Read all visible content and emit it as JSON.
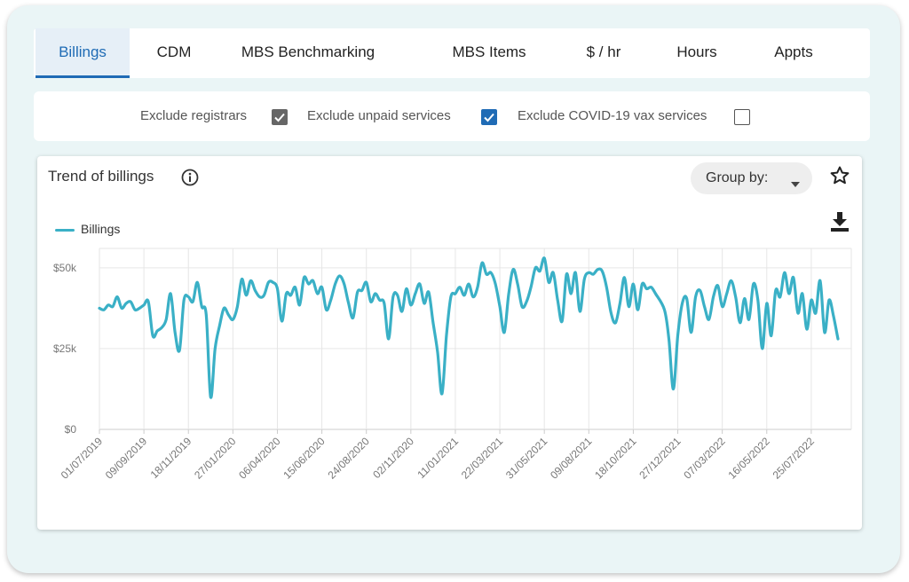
{
  "tabs": [
    {
      "label": "Billings",
      "active": true
    },
    {
      "label": "CDM",
      "active": false
    },
    {
      "label": "MBS Benchmarking",
      "active": false
    },
    {
      "label": "MBS Items",
      "active": false
    },
    {
      "label": "$ / hr",
      "active": false
    },
    {
      "label": "Hours",
      "active": false
    },
    {
      "label": "Appts",
      "active": false
    }
  ],
  "filters": [
    {
      "label": "Exclude registrars",
      "checked": true,
      "style": "gray"
    },
    {
      "label": "Exclude unpaid services",
      "checked": true,
      "style": "blue"
    },
    {
      "label": "Exclude COVID-19 vax services",
      "checked": false,
      "style": "none"
    }
  ],
  "colors": {
    "accent": "#1f6bb5",
    "series": "#3ab0c6",
    "checkbox_gray": "#666666",
    "checkbox_blue": "#1f6bb5"
  },
  "card": {
    "title": "Trend of billings",
    "group_by_label": "Group by:",
    "icons": [
      "info-icon",
      "star-icon",
      "download-icon",
      "caret-down-icon"
    ]
  },
  "chart_data": {
    "type": "line",
    "title": "Trend of billings",
    "xlabel": "",
    "ylabel": "",
    "ylim": [
      0,
      56000
    ],
    "y_ticks": [
      0,
      25000,
      50000
    ],
    "y_tick_labels": [
      "$0",
      "$25k",
      "$50k"
    ],
    "x_tick_labels": [
      "01/07/2019",
      "09/09/2019",
      "18/11/2019",
      "27/01/2020",
      "06/04/2020",
      "15/06/2020",
      "24/08/2020",
      "02/11/2020",
      "11/01/2021",
      "22/03/2021",
      "31/05/2021",
      "09/08/2021",
      "18/10/2021",
      "27/12/2021",
      "07/03/2022",
      "16/05/2022",
      "25/07/2022"
    ],
    "x_start": "2019-07-01",
    "x_end": "2022-09-26",
    "grid": true,
    "legend": "top-left",
    "series": [
      {
        "name": "Billings",
        "color": "#3ab0c6",
        "points": [
          [
            "2019-07-01",
            37500
          ],
          [
            "2019-07-08",
            37000
          ],
          [
            "2019-07-15",
            38500
          ],
          [
            "2019-07-22",
            38000
          ],
          [
            "2019-07-29",
            41000
          ],
          [
            "2019-08-05",
            37500
          ],
          [
            "2019-08-12",
            39000
          ],
          [
            "2019-08-19",
            39500
          ],
          [
            "2019-08-26",
            37000
          ],
          [
            "2019-09-02",
            37500
          ],
          [
            "2019-09-09",
            38500
          ],
          [
            "2019-09-16",
            39500
          ],
          [
            "2019-09-23",
            29000
          ],
          [
            "2019-09-30",
            30500
          ],
          [
            "2019-10-07",
            31500
          ],
          [
            "2019-10-14",
            34000
          ],
          [
            "2019-10-21",
            42000
          ],
          [
            "2019-10-28",
            30000
          ],
          [
            "2019-11-04",
            24500
          ],
          [
            "2019-11-11",
            40000
          ],
          [
            "2019-11-18",
            41000
          ],
          [
            "2019-11-25",
            39500
          ],
          [
            "2019-12-02",
            45500
          ],
          [
            "2019-12-09",
            38000
          ],
          [
            "2019-12-16",
            35500
          ],
          [
            "2019-12-23",
            10000
          ],
          [
            "2019-12-30",
            25000
          ],
          [
            "2020-01-06",
            32000
          ],
          [
            "2020-01-13",
            37500
          ],
          [
            "2020-01-20",
            35500
          ],
          [
            "2020-01-27",
            34000
          ],
          [
            "2020-02-03",
            38000
          ],
          [
            "2020-02-10",
            46500
          ],
          [
            "2020-02-17",
            41500
          ],
          [
            "2020-02-24",
            46000
          ],
          [
            "2020-03-02",
            43000
          ],
          [
            "2020-03-09",
            41000
          ],
          [
            "2020-03-16",
            41500
          ],
          [
            "2020-03-23",
            45500
          ],
          [
            "2020-03-30",
            45500
          ],
          [
            "2020-04-06",
            43500
          ],
          [
            "2020-04-13",
            33500
          ],
          [
            "2020-04-20",
            42000
          ],
          [
            "2020-04-27",
            41500
          ],
          [
            "2020-05-04",
            44000
          ],
          [
            "2020-05-11",
            38500
          ],
          [
            "2020-05-18",
            47000
          ],
          [
            "2020-05-25",
            45000
          ],
          [
            "2020-06-01",
            46000
          ],
          [
            "2020-06-08",
            42000
          ],
          [
            "2020-06-15",
            44000
          ],
          [
            "2020-06-22",
            37000
          ],
          [
            "2020-06-29",
            40000
          ],
          [
            "2020-07-06",
            45000
          ],
          [
            "2020-07-13",
            47500
          ],
          [
            "2020-07-20",
            45000
          ],
          [
            "2020-07-27",
            39000
          ],
          [
            "2020-08-03",
            34500
          ],
          [
            "2020-08-10",
            42500
          ],
          [
            "2020-08-17",
            43000
          ],
          [
            "2020-08-24",
            45500
          ],
          [
            "2020-08-31",
            39500
          ],
          [
            "2020-09-07",
            42000
          ],
          [
            "2020-09-14",
            40000
          ],
          [
            "2020-09-21",
            39000
          ],
          [
            "2020-09-28",
            28000
          ],
          [
            "2020-10-05",
            41000
          ],
          [
            "2020-10-12",
            41500
          ],
          [
            "2020-10-19",
            36500
          ],
          [
            "2020-10-26",
            43500
          ],
          [
            "2020-11-02",
            38500
          ],
          [
            "2020-11-09",
            42000
          ],
          [
            "2020-11-16",
            45000
          ],
          [
            "2020-11-23",
            39000
          ],
          [
            "2020-11-30",
            42500
          ],
          [
            "2020-12-07",
            33000
          ],
          [
            "2020-12-14",
            24000
          ],
          [
            "2020-12-21",
            11000
          ],
          [
            "2020-12-28",
            29000
          ],
          [
            "2021-01-04",
            41000
          ],
          [
            "2021-01-11",
            42000
          ],
          [
            "2021-01-18",
            44000
          ],
          [
            "2021-01-25",
            41500
          ],
          [
            "2021-02-01",
            45000
          ],
          [
            "2021-02-08",
            41000
          ],
          [
            "2021-02-15",
            44000
          ],
          [
            "2021-02-22",
            51500
          ],
          [
            "2021-03-01",
            48000
          ],
          [
            "2021-03-08",
            48500
          ],
          [
            "2021-03-15",
            45000
          ],
          [
            "2021-03-22",
            38000
          ],
          [
            "2021-03-29",
            30000
          ],
          [
            "2021-04-05",
            42000
          ],
          [
            "2021-04-12",
            49500
          ],
          [
            "2021-04-19",
            45000
          ],
          [
            "2021-04-26",
            38000
          ],
          [
            "2021-05-03",
            39500
          ],
          [
            "2021-05-10",
            44000
          ],
          [
            "2021-05-17",
            50000
          ],
          [
            "2021-05-24",
            49000
          ],
          [
            "2021-05-31",
            53000
          ],
          [
            "2021-06-07",
            45500
          ],
          [
            "2021-06-14",
            48500
          ],
          [
            "2021-06-21",
            40000
          ],
          [
            "2021-06-28",
            33500
          ],
          [
            "2021-07-05",
            48000
          ],
          [
            "2021-07-12",
            42000
          ],
          [
            "2021-07-19",
            48500
          ],
          [
            "2021-07-26",
            36500
          ],
          [
            "2021-08-02",
            46500
          ],
          [
            "2021-08-09",
            48500
          ],
          [
            "2021-08-16",
            48000
          ],
          [
            "2021-08-23",
            49500
          ],
          [
            "2021-08-30",
            49000
          ],
          [
            "2021-09-06",
            44000
          ],
          [
            "2021-09-13",
            36000
          ],
          [
            "2021-09-20",
            33000
          ],
          [
            "2021-09-27",
            39000
          ],
          [
            "2021-10-04",
            47000
          ],
          [
            "2021-10-11",
            38000
          ],
          [
            "2021-10-18",
            45000
          ],
          [
            "2021-10-25",
            37000
          ],
          [
            "2021-11-01",
            45000
          ],
          [
            "2021-11-08",
            43500
          ],
          [
            "2021-11-15",
            44000
          ],
          [
            "2021-11-22",
            42000
          ],
          [
            "2021-12-06",
            37000
          ],
          [
            "2021-12-13",
            28000
          ],
          [
            "2021-12-20",
            12500
          ],
          [
            "2021-12-27",
            29000
          ],
          [
            "2022-01-03",
            39000
          ],
          [
            "2022-01-10",
            40500
          ],
          [
            "2022-01-17",
            30000
          ],
          [
            "2022-01-24",
            41000
          ],
          [
            "2022-01-31",
            43000
          ],
          [
            "2022-02-07",
            38000
          ],
          [
            "2022-02-14",
            34000
          ],
          [
            "2022-02-21",
            41000
          ],
          [
            "2022-02-28",
            44500
          ],
          [
            "2022-03-07",
            38000
          ],
          [
            "2022-03-14",
            42000
          ],
          [
            "2022-03-21",
            46000
          ],
          [
            "2022-03-28",
            41000
          ],
          [
            "2022-04-04",
            33000
          ],
          [
            "2022-04-11",
            40500
          ],
          [
            "2022-04-18",
            34000
          ],
          [
            "2022-04-25",
            45000
          ],
          [
            "2022-05-02",
            40000
          ],
          [
            "2022-05-09",
            25000
          ],
          [
            "2022-05-16",
            39000
          ],
          [
            "2022-05-23",
            29000
          ],
          [
            "2022-05-30",
            43000
          ],
          [
            "2022-06-06",
            41000
          ],
          [
            "2022-06-13",
            48500
          ],
          [
            "2022-06-20",
            42000
          ],
          [
            "2022-06-27",
            47000
          ],
          [
            "2022-07-04",
            36000
          ],
          [
            "2022-07-11",
            42000
          ],
          [
            "2022-07-18",
            31000
          ],
          [
            "2022-07-25",
            40000
          ],
          [
            "2022-08-01",
            36000
          ],
          [
            "2022-08-08",
            46000
          ],
          [
            "2022-08-15",
            30000
          ],
          [
            "2022-08-22",
            40000
          ],
          [
            "2022-08-29",
            35000
          ],
          [
            "2022-09-05",
            28000
          ]
        ]
      }
    ]
  }
}
